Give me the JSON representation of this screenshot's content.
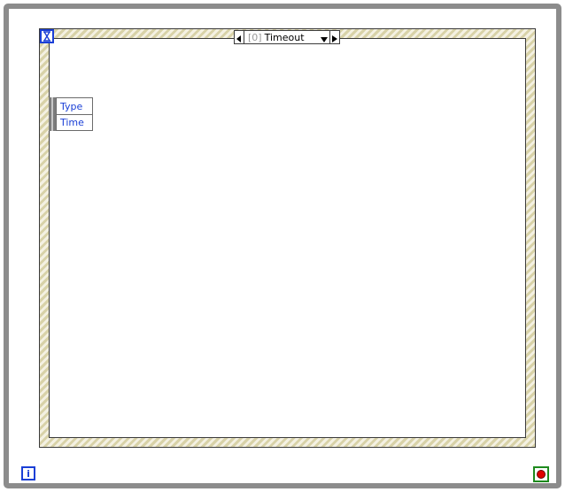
{
  "event_structure": {
    "case_selector": {
      "index": "[0]",
      "label": "Timeout"
    },
    "event_data_node": {
      "items": [
        "Type",
        "Time"
      ]
    },
    "timeout_terminal_icon": "hourglass-icon"
  },
  "while_loop": {
    "iteration_terminal": "i",
    "stop_condition_icon": "stop-circle-icon"
  },
  "colors": {
    "terminal_blue": "#1a3fd6",
    "stop_red": "#e00000",
    "stop_border_green": "#1e8a1e",
    "loop_border_gray": "#8c8c8c",
    "frame_hatch": "#d8d2a8"
  }
}
